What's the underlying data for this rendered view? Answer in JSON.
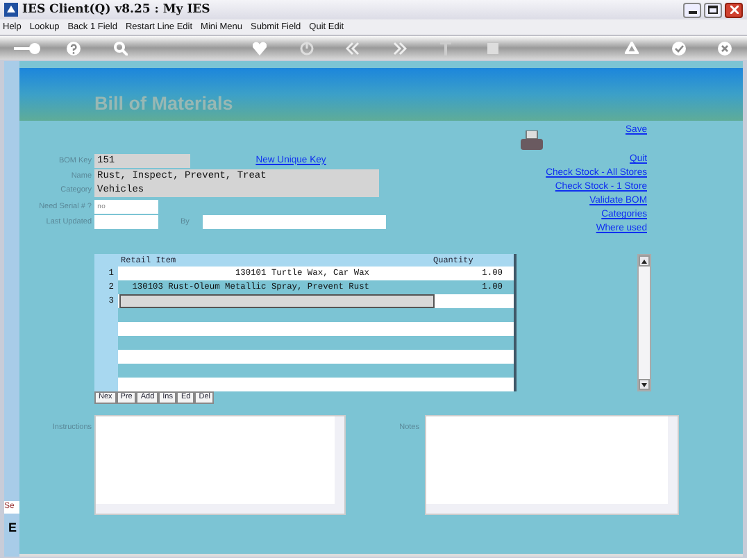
{
  "window": {
    "title": "IES Client(Q) v8.25 : My IES"
  },
  "menu": [
    "Help",
    "Lookup",
    "Back 1 Field",
    "Restart Line Edit",
    "Mini Menu",
    "Submit Field",
    "Quit Edit"
  ],
  "page_title": "Bill of Materials",
  "fields": [
    {
      "label": "BOM Key",
      "value": "151",
      "kind": "key",
      "link": "New Unique Key"
    },
    {
      "label": "Name",
      "value": "Rust, Inspect, Prevent, Treat",
      "kind": "wide"
    },
    {
      "label": "Category",
      "value": "Vehicles",
      "kind": "wide"
    },
    {
      "label": "Need Serial # ?",
      "value": "no",
      "kind": "short"
    },
    {
      "label": "Last Updated",
      "kind": "updated",
      "by_label": "By"
    }
  ],
  "actions": [
    "Save",
    "Quit",
    "Check Stock - All Stores",
    "Check Stock - 1 Store",
    "Validate BOM",
    "Categories",
    "Where used"
  ],
  "grid": {
    "columns": [
      "Retail Item",
      "Quantity"
    ],
    "rows": [
      {
        "number": "1",
        "item": "130101 Turtle Wax, Car Wax",
        "quantity": "1.00",
        "editing": false
      },
      {
        "number": "2",
        "item": "130103 Rust-Oleum Metallic Spray, Prevent Rust",
        "quantity": "1.00",
        "editing": false
      },
      {
        "number": "3",
        "editing": true
      }
    ],
    "buttons": [
      "Nex",
      "Pre",
      "Add",
      "Ins",
      "Ed",
      "Del"
    ]
  },
  "memo_fields": [
    {
      "label": "Instructions"
    },
    {
      "label": "Notes"
    }
  ],
  "side_strip": [
    "Se",
    "E"
  ]
}
